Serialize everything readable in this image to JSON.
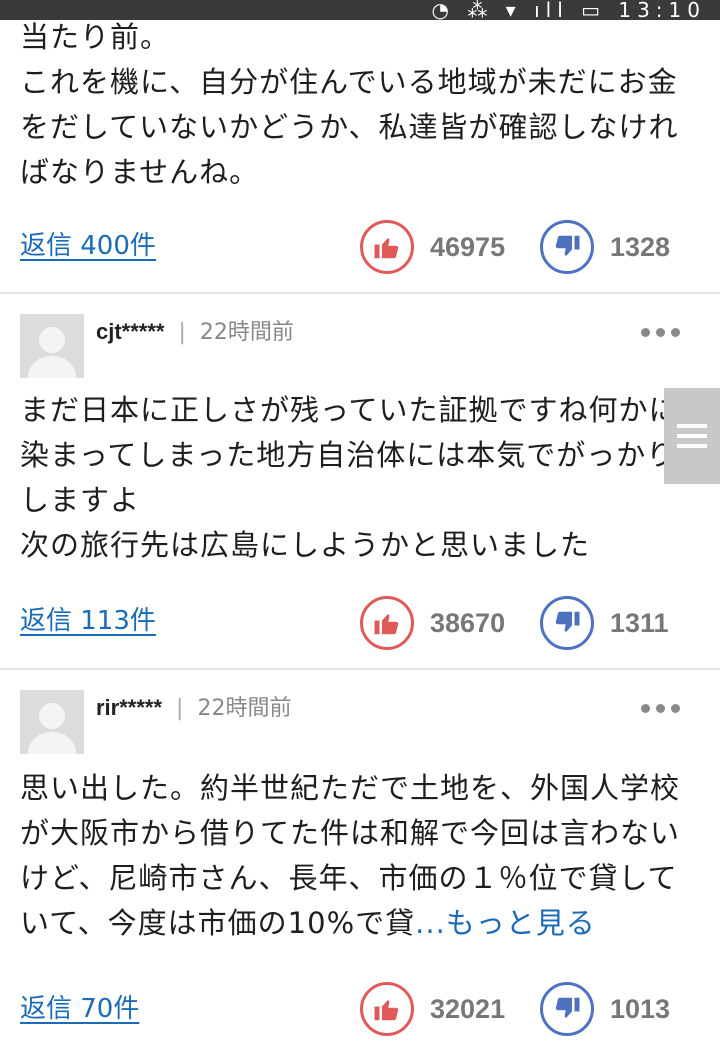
{
  "status_bar": {
    "time": "13:10"
  },
  "comments": [
    {
      "body": "当たり前。\nこれを機に、自分が住んでいる地域が未だにお金をだしていないかどうか、私達皆が確認しなければなりませんね。",
      "reply_label": "返信 400件",
      "likes": "46975",
      "dislikes": "1328"
    },
    {
      "user": "cjt*****",
      "time_ago": "22時間前",
      "body": "まだ日本に正しさが残っていた証拠ですね何かに染まってしまった地方自治体には本気でがっかりしますよ\n次の旅行先は広島にしようかと思いました",
      "reply_label": "返信 113件",
      "likes": "38670",
      "dislikes": "1311"
    },
    {
      "user": "rir*****",
      "time_ago": "22時間前",
      "body": "思い出した。約半世紀ただで土地を、外国人学校が大阪市から借りてた件は和解で今回は言わないけど、尼崎市さん、長年、市価の１％位で貸していて、今度は市価の10%で貸",
      "more_label": "...もっと見る",
      "reply_label": "返信 70件",
      "likes": "32021",
      "dislikes": "1013"
    }
  ],
  "colors": {
    "like": "#e15a5a",
    "dislike": "#4d72c2",
    "link": "#1a6bb8"
  },
  "icons": [
    "thumbs-up-icon",
    "thumbs-down-icon",
    "more-options-icon",
    "avatar-placeholder-icon",
    "side-menu-icon"
  ]
}
